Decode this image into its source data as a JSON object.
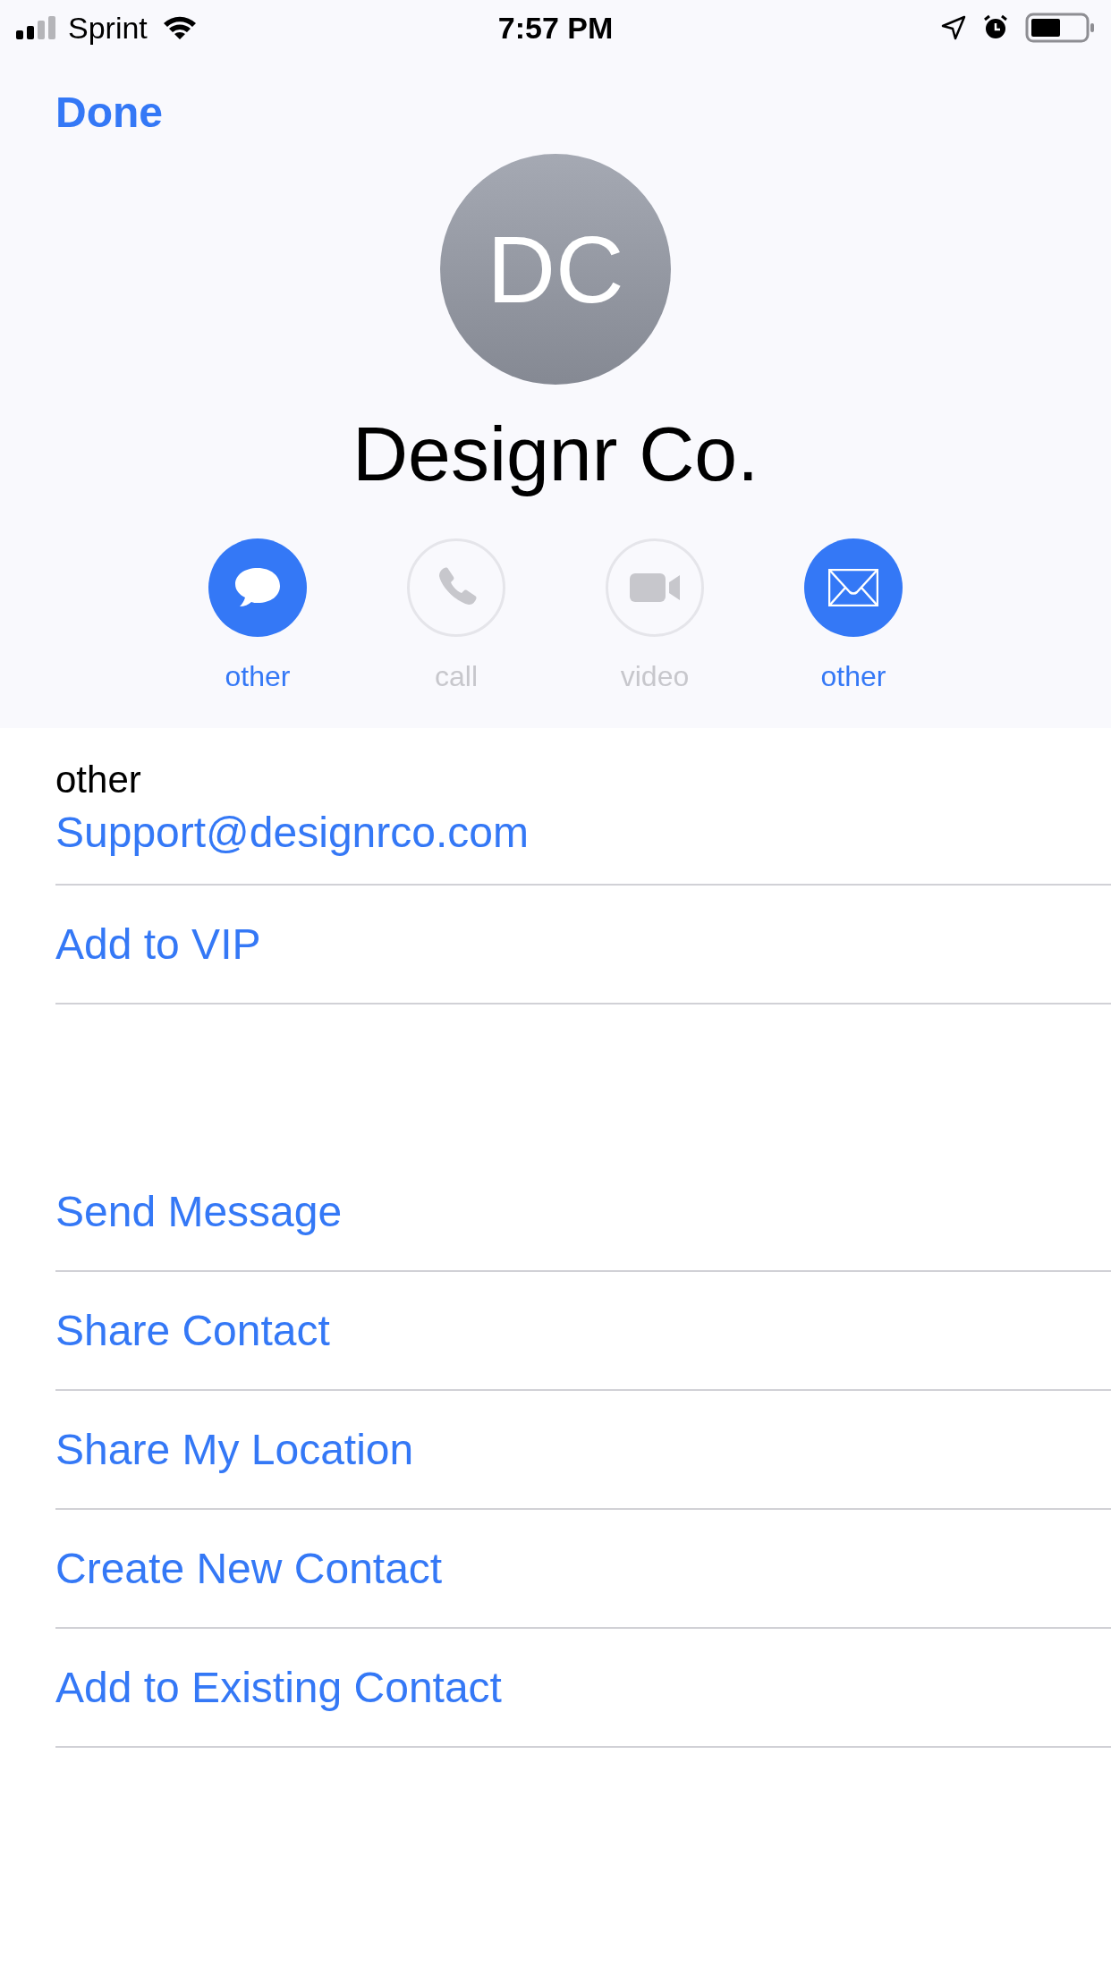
{
  "status_bar": {
    "carrier": "Sprint",
    "time": "7:57 PM"
  },
  "nav": {
    "done": "Done"
  },
  "contact": {
    "initials": "DC",
    "name": "Designr Co."
  },
  "actions": [
    {
      "kind": "message",
      "label": "other",
      "disabled": false
    },
    {
      "kind": "call",
      "label": "call",
      "disabled": true
    },
    {
      "kind": "video",
      "label": "video",
      "disabled": true
    },
    {
      "kind": "mail",
      "label": "other",
      "disabled": false
    }
  ],
  "email": {
    "label": "other",
    "value": "Support@designrco.com"
  },
  "vip": "Add to VIP",
  "options": [
    "Send Message",
    "Share Contact",
    "Share My Location",
    "Create New Contact",
    "Add to Existing Contact"
  ]
}
